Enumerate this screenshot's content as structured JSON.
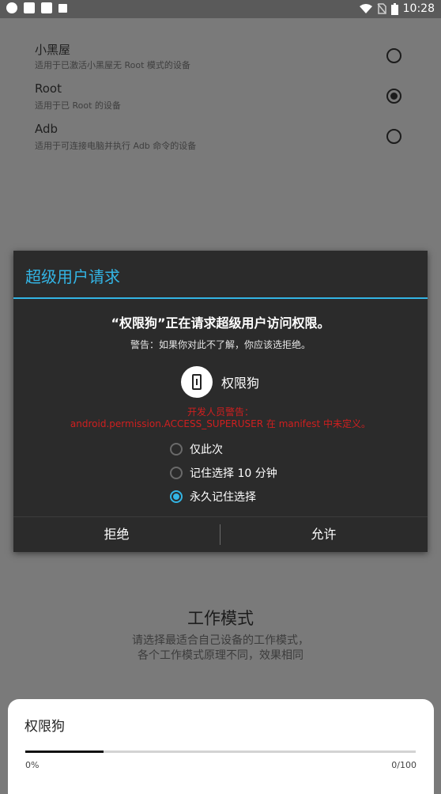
{
  "status_bar": {
    "time": "10:28",
    "icons": [
      "circle-icon",
      "app-icon",
      "bug-icon",
      "a-icon",
      "wifi-icon",
      "no-sim-icon",
      "battery-icon"
    ]
  },
  "modes": [
    {
      "title": "小黑屋",
      "desc": "适用于已激活小黑屋无 Root 模式的设备",
      "selected": false
    },
    {
      "title": "Root",
      "desc": "适用于已 Root 的设备",
      "selected": true
    },
    {
      "title": "Adb",
      "desc": "适用于可连接电脑并执行 Adb 命令的设备",
      "selected": false
    }
  ],
  "work_mode": {
    "title": "工作模式",
    "desc_line1": "请选择最适合自己设备的工作模式，",
    "desc_line2": "各个工作模式原理不同，效果相同"
  },
  "dialog": {
    "title": "超级用户请求",
    "heading": "“权限狗”正在请求超级用户访问权限。",
    "warning": "警告：如果你对此不了解，你应该选拒绝。",
    "app_name": "权限狗",
    "dev_warning_line1": "开发人员警告：",
    "dev_warning_line2": "android.permission.ACCESS_SUPERUSER 在 manifest 中未定义。",
    "options": [
      {
        "label": "仅此次",
        "selected": false
      },
      {
        "label": "记住选择 10 分钟",
        "selected": false
      },
      {
        "label": "永久记住选择",
        "selected": true
      }
    ],
    "deny_label": "拒绝",
    "allow_label": "允许",
    "accent_color": "#33b5e5"
  },
  "bottom_sheet": {
    "title": "权限狗",
    "progress_percent": "0%",
    "progress_count": "0/100",
    "bar_fill_fraction": 0.2
  }
}
